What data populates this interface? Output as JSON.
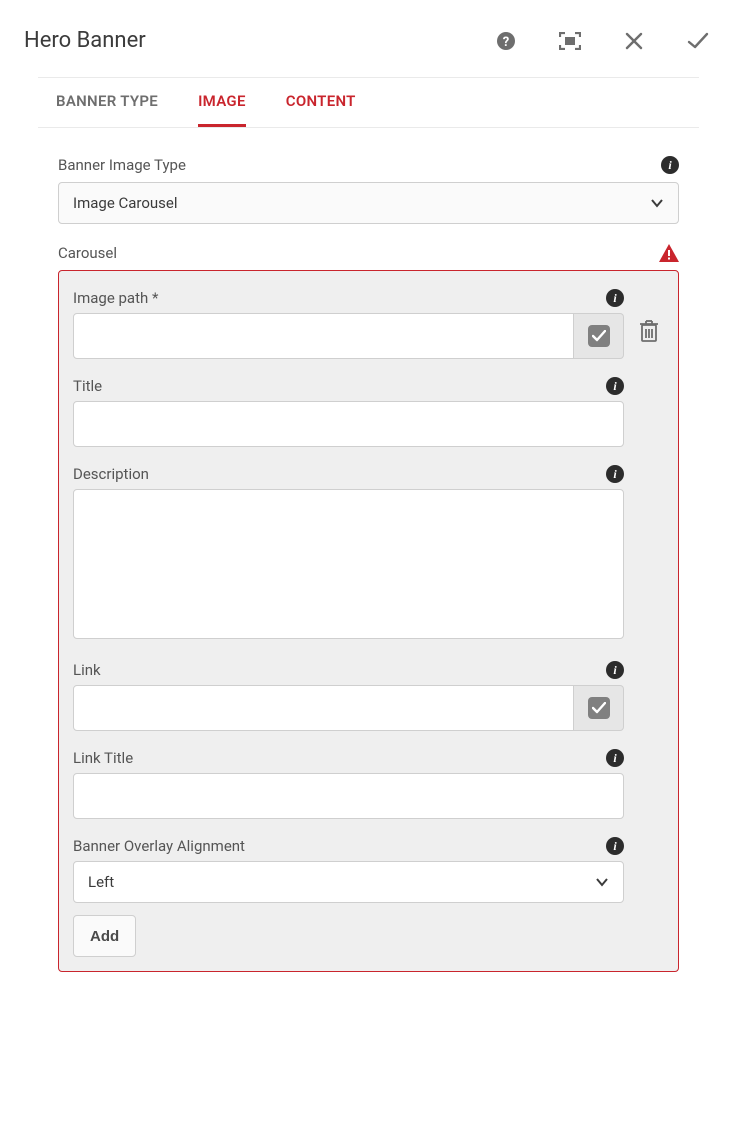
{
  "header": {
    "title": "Hero Banner"
  },
  "tabs": [
    {
      "label": "BANNER TYPE",
      "active": false,
      "accent": false
    },
    {
      "label": "IMAGE",
      "active": true,
      "accent": true
    },
    {
      "label": "CONTENT",
      "active": false,
      "accent": true
    }
  ],
  "bannerImageType": {
    "label": "Banner Image Type",
    "value": "Image Carousel"
  },
  "carousel": {
    "label": "Carousel",
    "items": [
      {
        "imagePath": {
          "label": "Image path *",
          "value": ""
        },
        "title": {
          "label": "Title",
          "value": ""
        },
        "description": {
          "label": "Description",
          "value": ""
        },
        "link": {
          "label": "Link",
          "value": ""
        },
        "linkTitle": {
          "label": "Link Title",
          "value": ""
        },
        "alignment": {
          "label": "Banner Overlay Alignment",
          "value": "Left"
        }
      }
    ],
    "addLabel": "Add"
  }
}
